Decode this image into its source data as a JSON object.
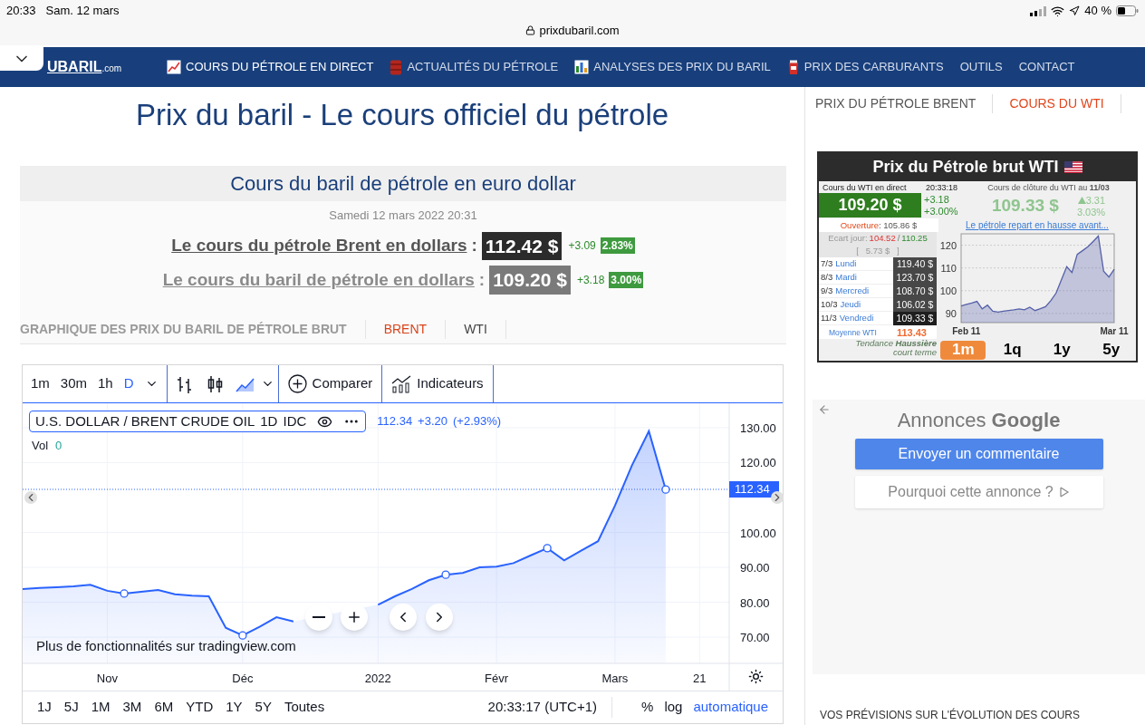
{
  "status_bar": {
    "time": "20:33",
    "date": "Sam. 12 mars",
    "battery": "40 %"
  },
  "address_bar": {
    "url": "prixdubaril.com"
  },
  "nav": {
    "logo": "UBARIL",
    "logo_suffix": ".com",
    "items": [
      {
        "label": "COURS DU PÉTROLE EN DIRECT",
        "kind": "chart",
        "selected": true
      },
      {
        "label": "ACTUALITÉS DU PÉTROLE",
        "kind": "barrel",
        "selected": false
      },
      {
        "label": "ANALYSES DES PRIX DU BARIL",
        "kind": "bars",
        "selected": false
      },
      {
        "label": "PRIX DES CARBURANTS",
        "kind": "fuel",
        "selected": false
      },
      {
        "label": "OUTILS",
        "kind": "text",
        "selected": false
      },
      {
        "label": "CONTACT",
        "kind": "text",
        "selected": false
      }
    ]
  },
  "page_title": "Prix du baril - Le cours officiel du pétrole",
  "quote_box": {
    "title": "Cours du baril de pétrole en euro dollar",
    "date": "Samedi 12 mars 2022 20:31",
    "rows": [
      {
        "label": "Le cours du pétrole Brent en dollars",
        "suffix": ":",
        "price": "112.42 $",
        "change": "+3.09",
        "percent": "2.83%",
        "highlighted": true
      },
      {
        "label": "Le cours du baril de pétrole en dollars",
        "suffix": ":",
        "price": "109.20 $",
        "change": "+3.18",
        "percent": "3.00%",
        "highlighted": false
      }
    ]
  },
  "chart_heading": "GRAPHIQUE DES PRIX DU BARIL DE PÉTROLE BRUT",
  "chart_tabs": [
    {
      "label": "BRENT",
      "selected": true
    },
    {
      "label": "WTI",
      "selected": false
    }
  ],
  "trading_chart": {
    "intervals": [
      {
        "label": "1m",
        "selected": false
      },
      {
        "label": "30m",
        "selected": false
      },
      {
        "label": "1h",
        "selected": false
      },
      {
        "label": "D",
        "selected": true
      }
    ],
    "chart_types": [
      {
        "kind": "bars",
        "selected": false
      },
      {
        "kind": "candles",
        "selected": false
      },
      {
        "kind": "area",
        "selected": true
      }
    ],
    "compare": "Comparer",
    "indicators": "Indicateurs",
    "legend": {
      "interval": "1D",
      "source": "IDC",
      "last": "112.34",
      "change": "+3.20",
      "change_percent": "(+2.93%)"
    },
    "volume": {
      "label": "Vol",
      "value": "0"
    },
    "price_tag": "112.34",
    "promo": "Plus de fonctionnalités sur tradingview.com",
    "chart_data": {
      "type": "area",
      "categories": [
        null,
        null,
        null,
        null,
        null,
        "Nov",
        null,
        null,
        null,
        null,
        null,
        null,
        null,
        "Déc",
        null,
        null,
        null,
        null,
        null,
        null,
        null,
        "2022",
        null,
        null,
        null,
        null,
        null,
        null,
        "Févr",
        null,
        null,
        null,
        null,
        null,
        null,
        "Mars",
        null,
        null,
        null,
        null,
        "21",
        null
      ],
      "series": [
        {
          "name": "U.S. DOLLAR / BRENT CRUDE OIL",
          "color": "#2962ff",
          "values": [
            83.8,
            84.1,
            84.3,
            84.6,
            85,
            83.3,
            82.5,
            83,
            83.5,
            82.3,
            81.9,
            81.7,
            72.7,
            70.5,
            73,
            75.7,
            74.5,
            null,
            null,
            null,
            null,
            79.3,
            81.7,
            83.8,
            86.3,
            87.9,
            88.4,
            90,
            90.2,
            91.2,
            93.4,
            95.5,
            92,
            94.8,
            97.5,
            107.7,
            119.2,
            129,
            112.3,
            null,
            null,
            null
          ]
        }
      ],
      "ylim": [
        62.5,
        137
      ],
      "grid": true,
      "ref_lines": [
        {
          "axis": "y",
          "value": 112.34,
          "color": "#2962ff"
        }
      ],
      "yticks": [
        {
          "value": 70,
          "label": "70.00"
        },
        {
          "value": 80,
          "label": "80.00"
        },
        {
          "value": 90,
          "label": "90.00"
        },
        {
          "value": 100,
          "label": "100.00"
        },
        {
          "value": 120,
          "label": "120.00"
        },
        {
          "value": 130,
          "label": "130.00"
        }
      ]
    },
    "ranges": [
      "1J",
      "5J",
      "1M",
      "3M",
      "6M",
      "YTD",
      "1Y",
      "5Y",
      "Toutes"
    ],
    "time": "20:33:17 (UTC+1)",
    "scale_options": [
      {
        "label": "%",
        "selected": false
      },
      {
        "label": "log",
        "selected": false
      },
      {
        "label": "automatique",
        "selected": true
      }
    ]
  },
  "sidebar_tabs": [
    {
      "label": "PRIX DU PÉTROLE BRENT",
      "selected": false
    },
    {
      "label": "COURS DU WTI",
      "selected": true
    }
  ],
  "wti_widget": {
    "title": "Prix du Pétrole brut WTI",
    "live_label": "Cours du WTI en direct",
    "live_time": "20:33:18",
    "live_price": "109.20 $",
    "live_change": "+3.18",
    "live_percent": "+3.00%",
    "close_label": "Cours de clôture du WTI au **11/03**",
    "close_price": "109.33 $",
    "close_change": "3.31",
    "close_percent": "3.03%",
    "news_link": "Le pétrole repart en hausse avant...",
    "open_label": "Ouverture",
    "open_value": ": 105.86 $",
    "range_label": "Ecart jour:",
    "range_low": "104.52",
    "range_sep": "/",
    "range_high": "110.25",
    "range_width": "[   5.73 $   ]",
    "days": [
      {
        "date": "7/3",
        "day": "Lundi",
        "price": "119.40 $",
        "color": "#474747"
      },
      {
        "date": "8/3",
        "day": "Mardi",
        "price": "123.70 $",
        "color": "#474747"
      },
      {
        "date": "9/3",
        "day": "Mercredi",
        "price": "108.70 $",
        "color": "#474747"
      },
      {
        "date": "10/3",
        "day": "Jeudi",
        "price": "106.02 $",
        "color": "#474747"
      },
      {
        "date": "11/3",
        "day": "Vendredi",
        "price": "109.33 $",
        "color": "#1e1e1e"
      }
    ],
    "average_label": "Moyenne WTI",
    "average_value": "113.43",
    "trend": "Tendance **Haussière**",
    "trend_sub": "court terme",
    "periods": [
      {
        "label": "1m",
        "selected": true
      },
      {
        "label": "1q",
        "selected": false
      },
      {
        "label": "1y",
        "selected": false
      },
      {
        "label": "5y",
        "selected": false
      }
    ],
    "chart_data": {
      "type": "area",
      "categories": [
        null,
        "Feb 11",
        null,
        null,
        null,
        null,
        null,
        null,
        null,
        null,
        null,
        null,
        null,
        null,
        null,
        null,
        null,
        null,
        null,
        null,
        null,
        null,
        null,
        null,
        null,
        null,
        null,
        null,
        null,
        "Mar 11"
      ],
      "series": [
        {
          "color": "#5560a8",
          "values": [
            93.3,
            94,
            94.6,
            95.3,
            92,
            93.7,
            91,
            90.6,
            91,
            91.3,
            91.6,
            92,
            91.6,
            92.8,
            91.3,
            92.1,
            93,
            95.7,
            99,
            104.8,
            110.6,
            108,
            116,
            117.6,
            119.3,
            121.6,
            124,
            108.6,
            106,
            109.4
          ]
        }
      ],
      "ylim": [
        86,
        125
      ],
      "grid": true,
      "yticks": [
        90,
        100,
        110,
        120
      ]
    }
  },
  "ads": {
    "heading": "Annonces **Google**",
    "feedback_button": "Envoyer un commentaire",
    "why_button": "Pourquoi cette annonce ?"
  },
  "footer_heading": "VOS PRÉVISIONS SUR L'ÉVOLUTION DES COURS"
}
